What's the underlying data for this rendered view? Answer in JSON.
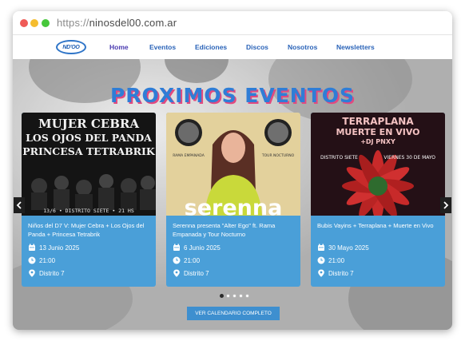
{
  "browser": {
    "url_protocol": "https://",
    "url_host": "ninosdel00.com.ar"
  },
  "logo": {
    "text": "ND'OO"
  },
  "nav": {
    "items": [
      "Home",
      "Eventos",
      "Ediciones",
      "Discos",
      "Nosotros",
      "Newsletters"
    ],
    "active": "Home"
  },
  "hero": {
    "title": "PROXIMOS EVENTOS",
    "cta": "VER CALENDARIO COMPLETO"
  },
  "carousel": {
    "total_dots": 5,
    "active_dot": 1
  },
  "events": [
    {
      "poster": {
        "line1": "MUJER CEBRA",
        "line2": "LOS OJOS DEL PANDA",
        "line3": "PRINCESA TETRABRIK",
        "footer": "13/6  •  DISTRITO SIETE  •  21 HS"
      },
      "title": "Niños del D7 V: Mujer Cebra + Los Ojos del Panda + Princesa Tetrabrik",
      "date": "13 Junio 2025",
      "time": "21:00",
      "venue": "Distrito 7"
    },
    {
      "poster": {
        "left_label": "RAMA EMPANADA",
        "right_label": "TOUR NOCTURNO",
        "big_text": "serenna"
      },
      "title": "Serenna presenta \"Alter Ego\" ft. Rama Empanada y Tour Nocturno",
      "date": "6 Junio 2025",
      "time": "21:00",
      "venue": "Distrito 7"
    },
    {
      "poster": {
        "line1": "TERRAPLANA",
        "line2": "MUERTE EN VIVO",
        "line3": "+DJ PNXY",
        "left_label": "DISTRITO SIETE",
        "right_label": "VIERNES 30 DE MAYO"
      },
      "title": "Bubis Vayins + Terraplana + Muerte en Vivo",
      "date": "30 Mayo 2025",
      "time": "21:00",
      "venue": "Distrito 7"
    }
  ],
  "colors": {
    "accent": "#2f7dd6",
    "card": "#4a9fd8",
    "title_shadow": "#e24a7f"
  },
  "icons": [
    "calendar-icon",
    "clock-icon",
    "location-pin-icon",
    "chevron-left-icon",
    "chevron-right-icon"
  ]
}
